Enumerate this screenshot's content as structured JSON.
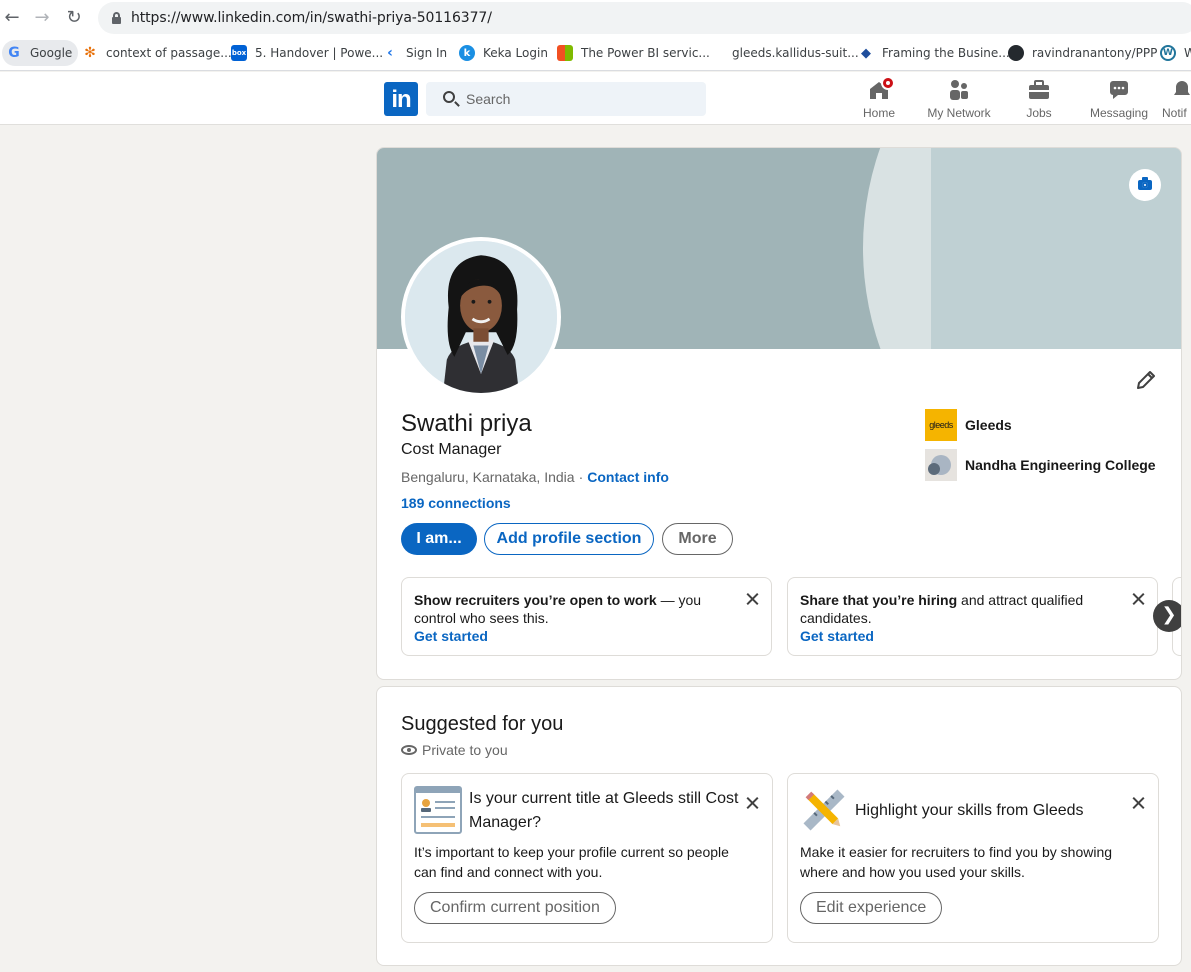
{
  "browser": {
    "url": "https://www.linkedin.com/in/swathi-priya-50116377/",
    "bookmarks": [
      {
        "label": "Google"
      },
      {
        "label": "context of passage..."
      },
      {
        "label": "5. Handover | Powe..."
      },
      {
        "label": "Sign In"
      },
      {
        "label": "Keka Login"
      },
      {
        "label": "The Power BI servic..."
      },
      {
        "label": "gleeds.kallidus-suit..."
      },
      {
        "label": "Framing the Busine..."
      },
      {
        "label": "ravindranantony/PPP"
      },
      {
        "label": "W"
      }
    ]
  },
  "header": {
    "search_placeholder": "Search",
    "nav": [
      {
        "label": "Home"
      },
      {
        "label": "My Network"
      },
      {
        "label": "Jobs"
      },
      {
        "label": "Messaging"
      },
      {
        "label": "Notif"
      }
    ]
  },
  "profile": {
    "name": "Swathi priya",
    "headline": "Cost Manager",
    "location": "Bengaluru, Karnataka, India",
    "separator": "·",
    "contact_info": "Contact info",
    "connections": "189 connections",
    "buttons": {
      "open_to": "I am...",
      "add_section": "Add profile section",
      "more": "More"
    },
    "organizations": [
      {
        "name": "Gleeds",
        "logo_text": "gleeds"
      },
      {
        "name": "Nandha Engineering College"
      }
    ],
    "promos": [
      {
        "bold": "Show recruiters you’re open to work",
        "rest": " — you control who sees this.",
        "cta": "Get started"
      },
      {
        "bold": "Share that you’re hiring",
        "rest": " and attract qualified candidates.",
        "cta": "Get started"
      }
    ],
    "carousel_next": "❯"
  },
  "suggested": {
    "title": "Suggested for you",
    "privacy": "Private to you",
    "cards": [
      {
        "title": "Is your current title at Gleeds still Cost Manager?",
        "body": "It’s important to keep your profile current so people can find and connect with you.",
        "button": "Confirm current position"
      },
      {
        "title": "Highlight your skills from Gleeds",
        "body": "Make it easier for recruiters to find you by showing where and how you used your skills.",
        "button": "Edit experience"
      }
    ]
  },
  "colors": {
    "brand": "#0a66c2",
    "notification": "#cc1016",
    "gleeds_logo": "#f5b400"
  }
}
